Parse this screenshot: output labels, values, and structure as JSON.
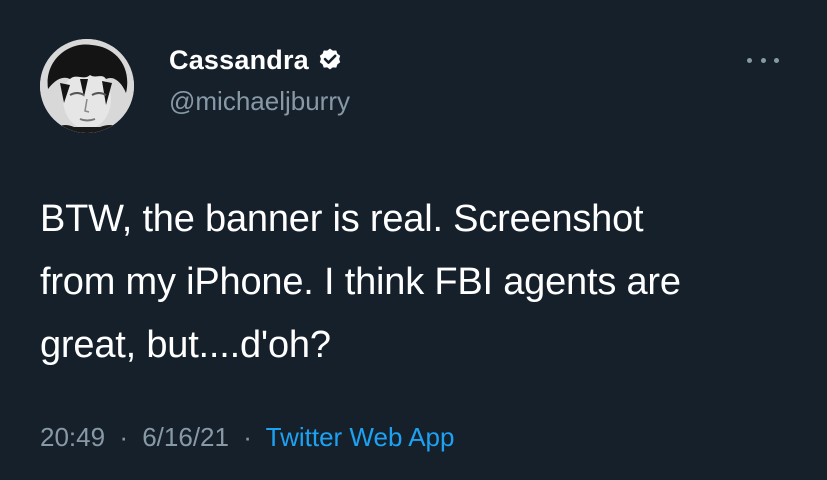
{
  "tweet": {
    "author": {
      "display_name": "Cassandra",
      "handle": "@michaeljburry",
      "verified": true,
      "avatar_icon": "avatar-photo"
    },
    "more_icon": "more-options-icon",
    "text_lines": [
      "BTW, the banner is real. Screenshot",
      "from my iPhone. I think FBI agents are",
      "great, but....d'oh?"
    ],
    "meta": {
      "time": "20:49",
      "separator": "·",
      "date": "6/16/21",
      "source": "Twitter Web App"
    }
  },
  "colors": {
    "background": "#15202b",
    "text": "#ffffff",
    "secondary": "#8899a6",
    "accent": "#1da1f2"
  }
}
